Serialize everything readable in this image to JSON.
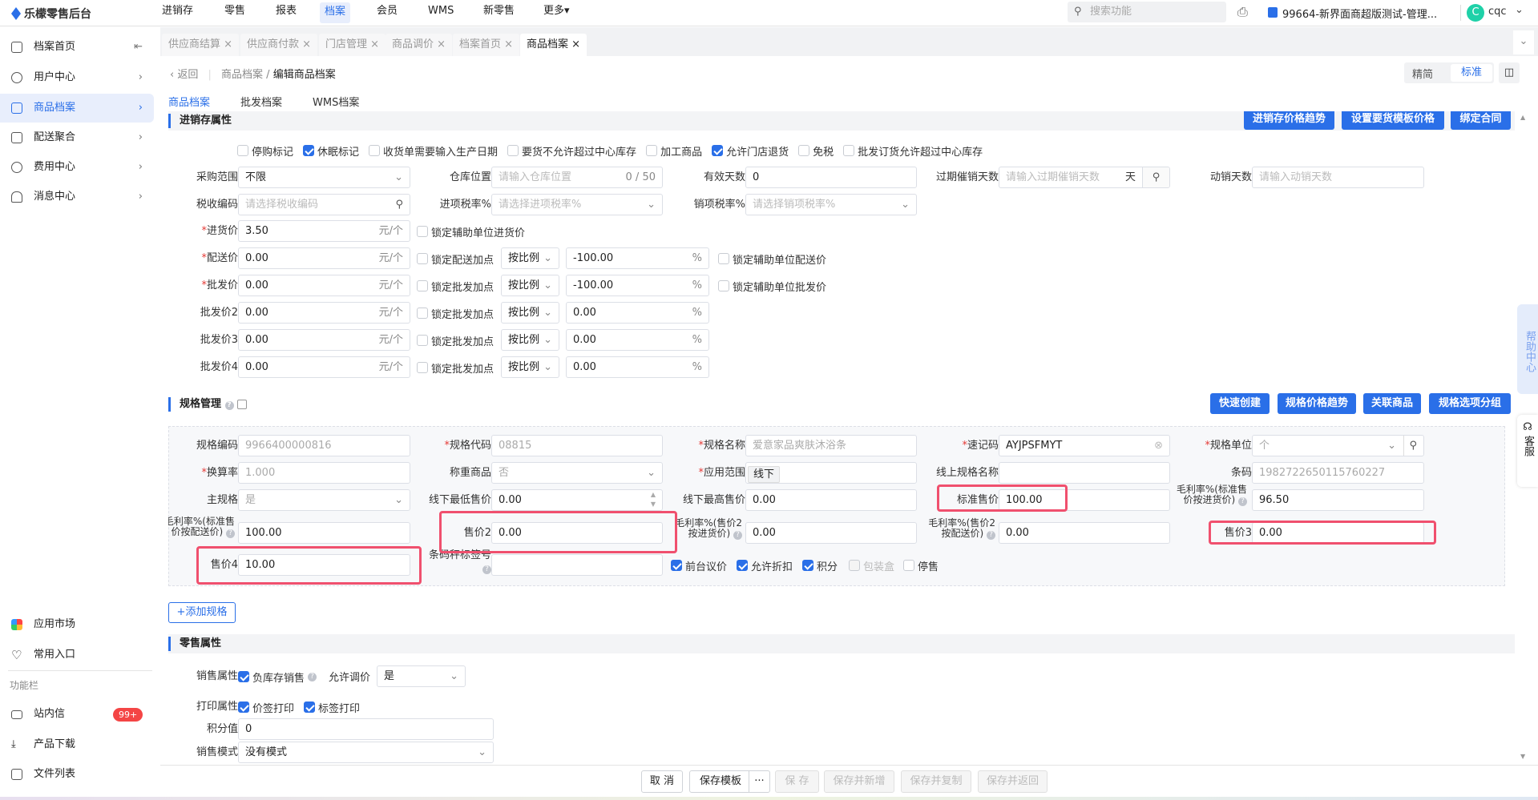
{
  "app": {
    "title": "乐檬零售后台"
  },
  "topnav": [
    "进销存",
    "零售",
    "报表",
    "档案",
    "会员",
    "WMS",
    "新零售",
    "更多▾"
  ],
  "search": {
    "placeholder": "搜索功能"
  },
  "store": "99664-新界面商超版测试-管理...",
  "user": {
    "avatar": "C",
    "name": "cqc"
  },
  "sidebar": {
    "items": [
      {
        "label": "档案首页"
      },
      {
        "label": "用户中心"
      },
      {
        "label": "商品档案"
      },
      {
        "label": "配送聚合"
      },
      {
        "label": "费用中心"
      },
      {
        "label": "消息中心"
      }
    ],
    "bottom": [
      {
        "label": "应用市场"
      },
      {
        "label": "常用入口"
      }
    ],
    "section": "功能栏",
    "tools": [
      {
        "label": "站内信",
        "badge": "99+"
      },
      {
        "label": "产品下载"
      },
      {
        "label": "文件列表"
      }
    ]
  },
  "tabs": [
    "供应商结算",
    "供应商付款",
    "门店管理",
    "商品调价",
    "档案首页",
    "商品档案"
  ],
  "breadcrumb": {
    "back": "返回",
    "parent": "商品档案",
    "current": "编辑商品档案"
  },
  "view_toggle": [
    "精简",
    "标准"
  ],
  "subtabs": [
    "商品档案",
    "批发档案",
    "WMS档案"
  ],
  "inventory": {
    "title": "进销存属性",
    "buttons": [
      "进销存价格趋势",
      "设置要货模板价格",
      "绑定合同"
    ],
    "flags": [
      {
        "label": "停购标记",
        "checked": false
      },
      {
        "label": "休眠标记",
        "checked": true
      },
      {
        "label": "收货单需要输入生产日期",
        "checked": false
      },
      {
        "label": "要货不允许超过中心库存",
        "checked": false
      },
      {
        "label": "加工商品",
        "checked": false
      },
      {
        "label": "允许门店退货",
        "checked": true
      },
      {
        "label": "免税",
        "checked": false
      },
      {
        "label": "批发订货允许超过中心库存",
        "checked": false
      }
    ],
    "purchase_scope": {
      "label": "采购范围",
      "value": "不限"
    },
    "warehouse": {
      "label": "仓库位置",
      "placeholder": "请输入仓库位置",
      "counter": "0 / 50"
    },
    "valid_days": {
      "label": "有效天数",
      "value": "0"
    },
    "expiry_days": {
      "label": "过期催销天数",
      "placeholder": "请输入过期催销天数",
      "unit": "天"
    },
    "move_days": {
      "label": "动销天数",
      "placeholder": "请输入动销天数"
    },
    "tax_code": {
      "label": "税收编码",
      "placeholder": "请选择税收编码"
    },
    "input_tax": {
      "label": "进项税率%",
      "placeholder": "请选择进项税率%"
    },
    "output_tax": {
      "label": "销项税率%",
      "placeholder": "请选择销项税率%"
    },
    "unit_suffix": "元/个",
    "pct": "%",
    "purchase_price": {
      "label": "进货价",
      "value": "3.50",
      "lock": "锁定辅助单位进货价"
    },
    "prices": [
      {
        "label": "配送价",
        "required": true,
        "value": "0.00",
        "lock": "锁定配送加点",
        "mode": "按比例",
        "rate": "-100.00",
        "aux": "锁定辅助单位配送价"
      },
      {
        "label": "批发价",
        "required": true,
        "value": "0.00",
        "lock": "锁定批发加点",
        "mode": "按比例",
        "rate": "-100.00",
        "aux": "锁定辅助单位批发价"
      },
      {
        "label": "批发价2",
        "value": "0.00",
        "lock": "锁定批发加点",
        "mode": "按比例",
        "rate": "0.00"
      },
      {
        "label": "批发价3",
        "value": "0.00",
        "lock": "锁定批发加点",
        "mode": "按比例",
        "rate": "0.00"
      },
      {
        "label": "批发价4",
        "value": "0.00",
        "lock": "锁定批发加点",
        "mode": "按比例",
        "rate": "0.00"
      }
    ]
  },
  "spec": {
    "title": "规格管理",
    "buttons": [
      "快速创建",
      "规格价格趋势",
      "关联商品",
      "规格选项分组"
    ],
    "code": {
      "label": "规格编码",
      "value": "9966400000816"
    },
    "spec_code": {
      "label": "规格代码",
      "value": "08815"
    },
    "name": {
      "label": "规格名称",
      "value": "爱意家品爽肤沐浴条"
    },
    "shortcode": {
      "label": "速记码",
      "value": "AYJPSFMYT"
    },
    "unit": {
      "label": "规格单位",
      "value": "个"
    },
    "ratio": {
      "label": "换算率",
      "value": "1.000"
    },
    "weighed": {
      "label": "称重商品",
      "value": "否"
    },
    "scope": {
      "label": "应用范围",
      "value": "线下"
    },
    "online_name": {
      "label": "线上规格名称",
      "value": ""
    },
    "barcode": {
      "label": "条码",
      "value": "1982722650115760227"
    },
    "main_spec": {
      "label": "主规格",
      "value": "是"
    },
    "min_price": {
      "label": "线下最低售价",
      "value": "0.00"
    },
    "max_price": {
      "label": "线下最高售价",
      "value": "0.00"
    },
    "std_price": {
      "label": "标准售价",
      "value": "100.00"
    },
    "margin_std_purchase": {
      "label": "毛利率%(标准售价按进货价)",
      "value": "96.50"
    },
    "margin_std_dist": {
      "label": "毛利率%(标准售价按配送价)",
      "value": "100.00"
    },
    "price2": {
      "label": "售价2",
      "value": "0.00"
    },
    "margin_p2_purchase": {
      "label": "毛利率%(售价2按进货价)",
      "value": "0.00"
    },
    "margin_p2_dist": {
      "label": "毛利率%(售价2按配送价)",
      "value": "0.00"
    },
    "price3": {
      "label": "售价3",
      "value": "0.00"
    },
    "price4": {
      "label": "售价4",
      "value": "10.00"
    },
    "scale_label": {
      "label": "条码秤标签号",
      "value": ""
    },
    "options": [
      {
        "label": "前台议价",
        "checked": true
      },
      {
        "label": "允许折扣",
        "checked": true
      },
      {
        "label": "积分",
        "checked": true
      },
      {
        "label": "包装盒",
        "checked": false,
        "disabled": true
      },
      {
        "label": "停售",
        "checked": false
      }
    ],
    "add_button": "+添加规格"
  },
  "retail": {
    "title": "零售属性",
    "sale_attr": {
      "label": "销售属性",
      "option": "负库存销售"
    },
    "allow_adjust": {
      "label": "允许调价",
      "value": "是"
    },
    "print_attr": {
      "label": "打印属性",
      "options": [
        "价签打印",
        "标签打印"
      ]
    },
    "points": {
      "label": "积分值",
      "value": "0"
    },
    "sale_mode": {
      "label": "销售模式",
      "value": "没有模式"
    }
  },
  "help": {
    "help_center": "帮助中心",
    "service": "客服"
  },
  "actions": {
    "cancel": "取 消",
    "save_template": "保存模板",
    "more": "···",
    "save": "保 存",
    "save_new": "保存并新增",
    "save_copy": "保存并复制",
    "save_return": "保存并返回"
  }
}
